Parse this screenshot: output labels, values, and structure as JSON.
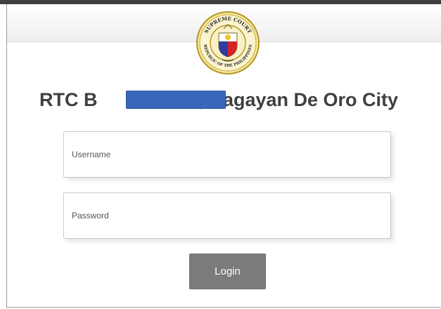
{
  "header": {
    "seal": {
      "name": "supreme-court-seal",
      "text_top": "SUPREME COURT",
      "text_bottom": "REPUBLIC OF THE PHILIPPINES"
    },
    "title_prefix": "RTC B",
    "title_suffix": ", Cagayan De Oro City"
  },
  "form": {
    "username_placeholder": "Username",
    "password_placeholder": "Password",
    "login_label": "Login"
  },
  "colors": {
    "redaction": "#3866b8",
    "button": "#7b7b7b",
    "title": "#404040"
  }
}
